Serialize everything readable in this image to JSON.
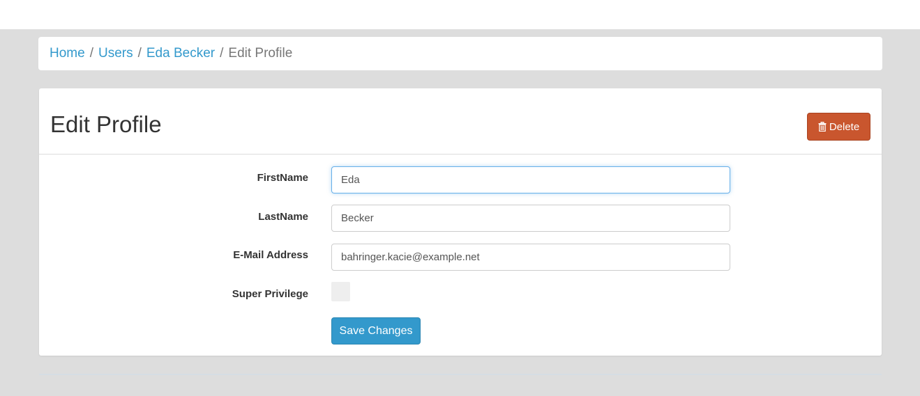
{
  "breadcrumb": {
    "items": [
      {
        "label": "Home"
      },
      {
        "label": "Users"
      },
      {
        "label": "Eda Becker"
      }
    ],
    "separator": "/",
    "current": "Edit Profile"
  },
  "panel": {
    "title": "Edit Profile",
    "delete_label": "Delete",
    "delete_icon": "trash-icon"
  },
  "form": {
    "first_name": {
      "label": "FirstName",
      "value": "Eda"
    },
    "last_name": {
      "label": "LastName",
      "value": "Becker"
    },
    "email": {
      "label": "E-Mail Address",
      "value": "bahringer.kacie@example.net"
    },
    "super_privilege": {
      "label": "Super Privilege",
      "checked": false
    },
    "save_label": "Save Changes"
  },
  "colors": {
    "link": "#3399cc",
    "primary": "#3399cc",
    "danger": "#c9562e",
    "background": "#dddddd"
  }
}
